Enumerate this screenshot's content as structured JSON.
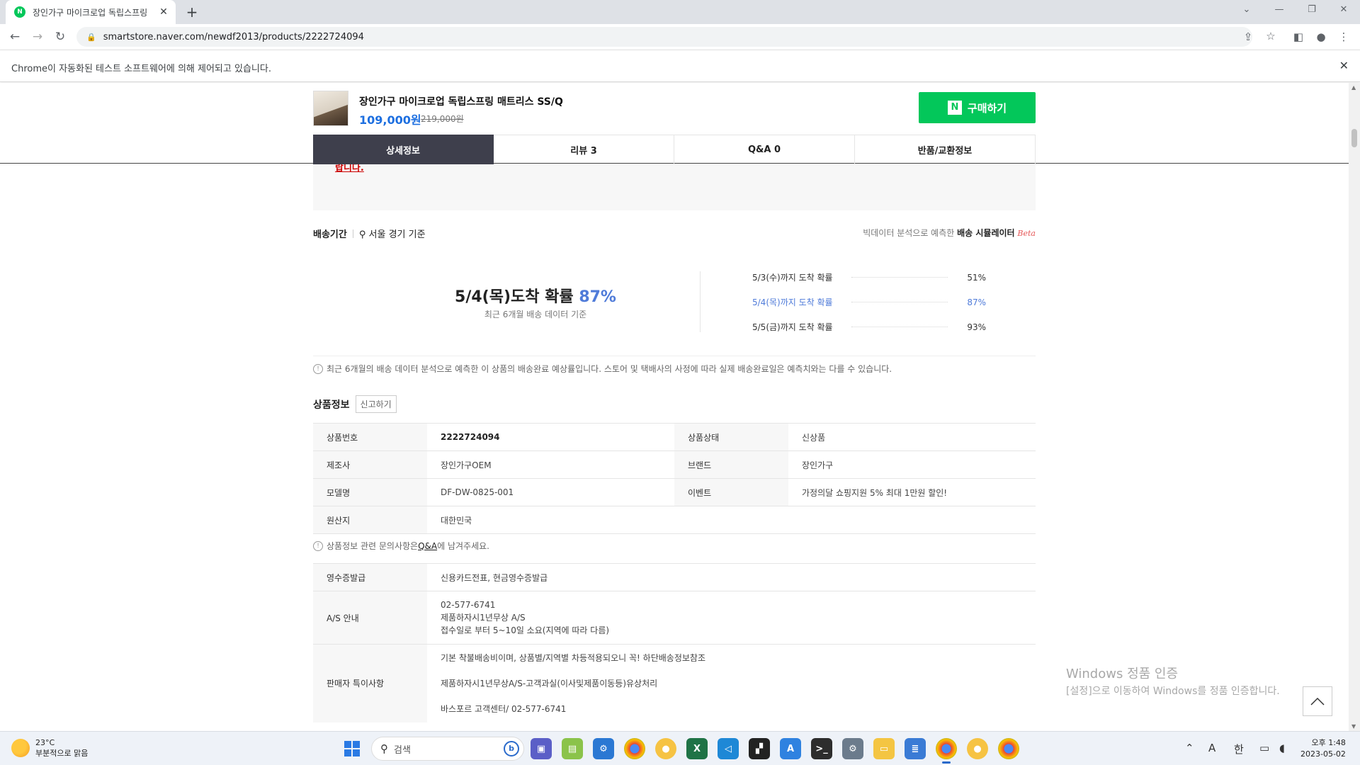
{
  "browser": {
    "tab_title": "장인가구 마이크로업 독립스프링",
    "favicon_label": "N",
    "new_tab_label": "+",
    "url": "smartstore.naver.com/newdf2013/products/2222724094",
    "automation_notice": "Chrome이 자동화된 테스트 소프트웨어에 의해 제어되고 있습니다."
  },
  "product": {
    "name": "장인가구 마이크로업 독립스프링 매트리스 SS/Q",
    "price": "109,000원",
    "original_price": "219,000원",
    "buy_label": "구매하기",
    "buy_icon_letter": "N"
  },
  "tabs": [
    {
      "label": "상세정보",
      "active": true
    },
    {
      "label": "리뷰 3",
      "active": false
    },
    {
      "label": "Q&A 0",
      "active": false
    },
    {
      "label": "반품/교환정보",
      "active": false
    }
  ],
  "notice": {
    "tail": "랍니다."
  },
  "delivery": {
    "label": "배송기간",
    "location": "서울 경기 기준",
    "simulator_prefix": "빅데이터 분석으로 예측한",
    "simulator_name": "배송 시뮬레이터",
    "beta": "Beta",
    "main_prefix": "5/4(목)도착 확률",
    "main_pct": "87%",
    "main_sub": "최근 6개월 배송 데이터 기준",
    "rows": [
      {
        "date": "5/3(수)까지 도착 확률",
        "value": "51%",
        "highlight": false
      },
      {
        "date": "5/4(목)까지 도착 확률",
        "value": "87%",
        "highlight": true
      },
      {
        "date": "5/5(금)까지 도착 확률",
        "value": "93%",
        "highlight": false
      }
    ],
    "disclaimer": "최근 6개월의 배송 데이터 분석으로 예측한 이 상품의 배송완료 예상률입니다. 스토어 및 택배사의 사정에 따라 실제 배송완료일은 예측치와는 다를 수 있습니다."
  },
  "product_info": {
    "title": "상품정보",
    "report_label": "신고하기",
    "rows": [
      {
        "k1": "상품번호",
        "v1": "2222724094",
        "k2": "상품상태",
        "v2": "신상품"
      },
      {
        "k1": "제조사",
        "v1": "장인가구OEM",
        "k2": "브랜드",
        "v2": "장인가구"
      },
      {
        "k1": "모델명",
        "v1": "DF-DW-0825-001",
        "k2": "이벤트",
        "v2": "가정의달 쇼핑지원 5% 최대 1만원 할인!"
      },
      {
        "k1": "원산지",
        "v1": "대한민국",
        "k2": "",
        "v2": ""
      }
    ],
    "qa_note_prefix": "상품정보 관련 문의사항은 ",
    "qa_note_link": "Q&A",
    "qa_note_suffix": "에 남겨주세요."
  },
  "extra_info": {
    "receipt_label": "영수증발급",
    "receipt_value": "신용카드전표, 현금영수증발급",
    "as_label": "A/S 안내",
    "as_lines": [
      "02-577-6741",
      "제품하자시1년무상 A/S",
      "접수일로 부터 5~10일 소요(지역에 따라 다름)"
    ],
    "seller_label": "판매자 특이사항",
    "seller_lines": [
      "기본 착불배송비이며, 상품별/지역별 차등적용되오니 꼭! 하단배송정보참조",
      "제품하자시1년무상A/S-고객과실(이사및제품이동등)유상처리",
      "바스포르 고객센터/ 02-577-6741"
    ]
  },
  "watermark": {
    "line1": "Windows 정품 인증",
    "line2": "[설정]으로 이동하여 Windows를 정품 인증합니다."
  },
  "taskbar": {
    "temp": "23°C",
    "weather": "부분적으로 맑음",
    "search_placeholder": "검색",
    "bing_label": "b",
    "ime_label": "A",
    "lang": "한",
    "time": "오후 1:48",
    "date": "2023-05-02"
  },
  "colors": {
    "naver_green": "#03c75a",
    "active_tab": "#3e3f4c",
    "price_blue": "#1d6fe0",
    "prob_blue": "#4f7bd9"
  }
}
